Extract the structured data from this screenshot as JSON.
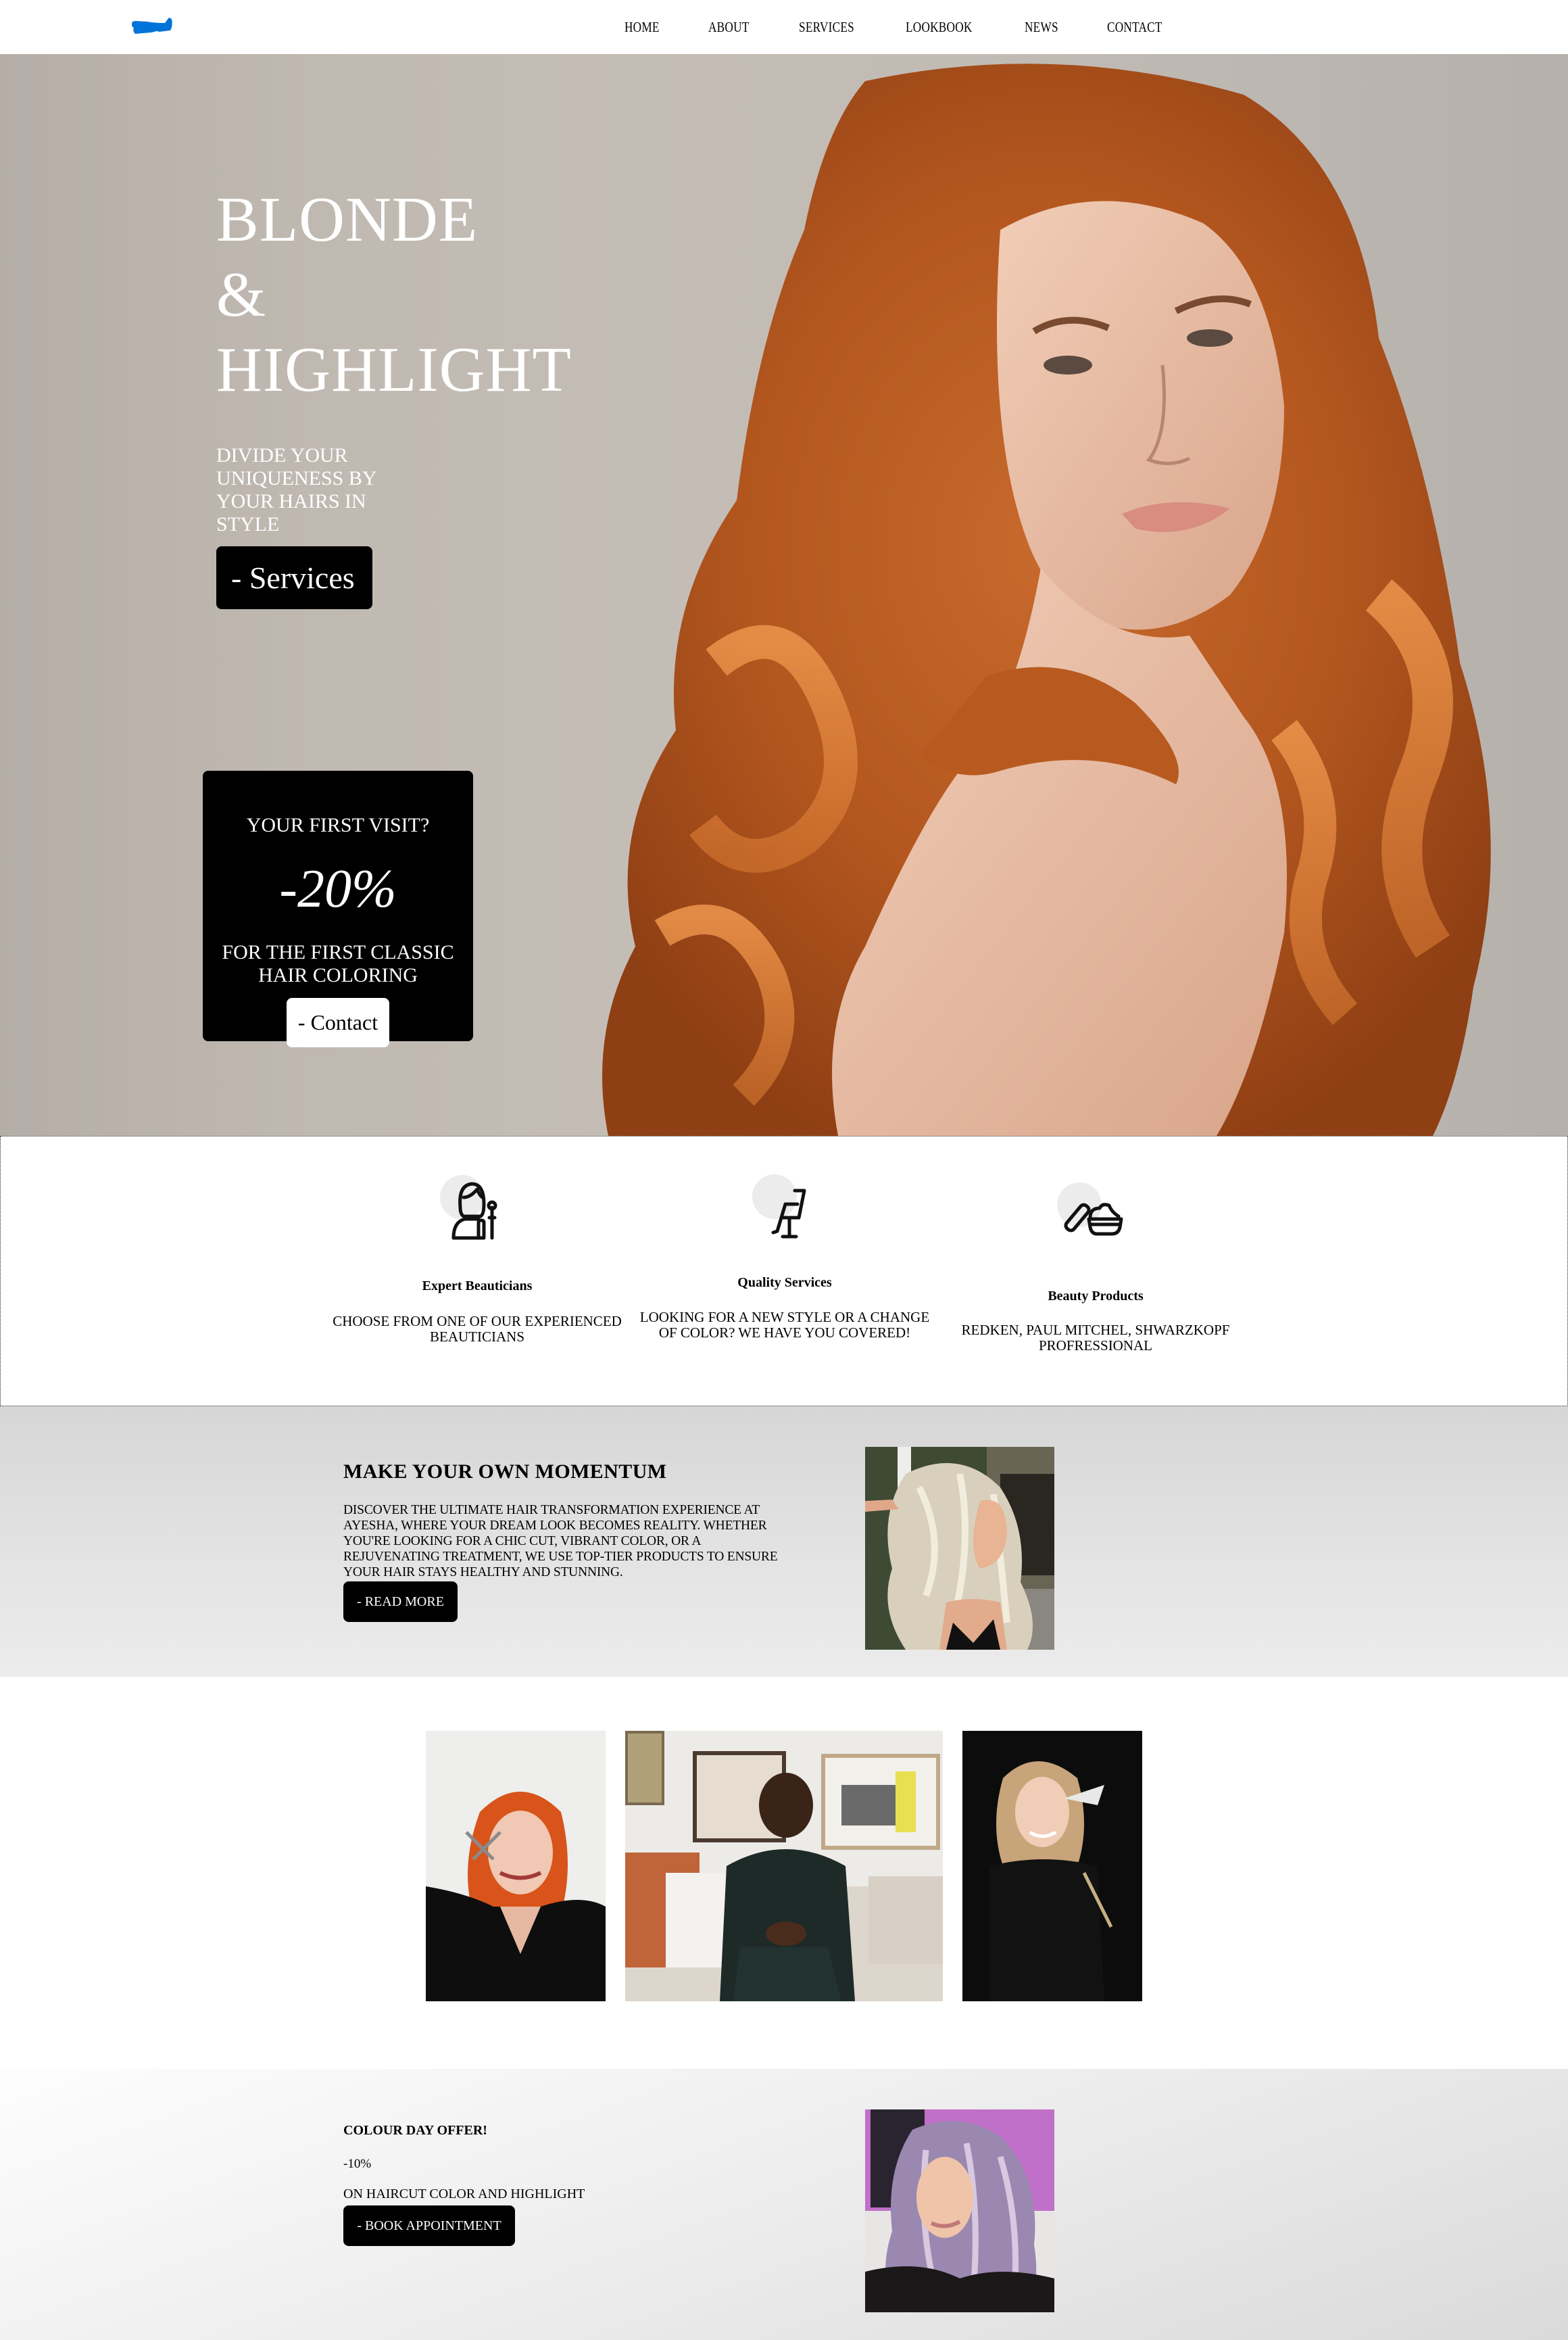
{
  "header": {
    "logo_alt": "Salon logo (blue brush stroke)",
    "logo_color": "#0074d9",
    "nav": [
      {
        "label": "HOME"
      },
      {
        "label": "ABOUT"
      },
      {
        "label": "SERVICES"
      },
      {
        "label": "LOOKBOOK"
      },
      {
        "label": "NEWS"
      },
      {
        "label": "CONTACT"
      }
    ]
  },
  "hero": {
    "title_lines": [
      "BLONDE",
      "&",
      "HIGHLIGHT"
    ],
    "subtitle": "DIVIDE YOUR UNIQUENESS BY YOUR HAIRS IN STYLE",
    "services_button": "- Services",
    "image_alt": "Woman with long wavy copper-red hair",
    "promo": {
      "question": "YOUR FIRST VISIT?",
      "discount": "-20%",
      "description": "FOR THE FIRST CLASSIC HAIR COLORING",
      "contact_button": "- Contact"
    }
  },
  "features": [
    {
      "icon": "beautician-icon",
      "title": "Expert Beauticians",
      "description": "CHOOSE FROM ONE OF OUR EXPERIENCED BEAUTICIANS"
    },
    {
      "icon": "salon-chair-icon",
      "title": "Quality Services",
      "description": "LOOKING FOR A NEW STYLE OR A CHANGE OF COLOR? WE HAVE YOU COVERED!"
    },
    {
      "icon": "cream-jar-icon",
      "title": "Beauty Products",
      "description": "REDKEN, PAUL MITCHEL, SHWARZKOPF PROFRESSIONAL"
    }
  ],
  "momentum": {
    "title": "MAKE YOUR OWN MOMENTUM",
    "body": "DISCOVER THE ULTIMATE HAIR TRANSFORMATION EXPERIENCE AT AYESHA, WHERE YOUR DREAM LOOK BECOMES REALITY. WHETHER YOU'RE LOOKING FOR A CHIC CUT, VIBRANT COLOR, OR A REJUVENATING TREATMENT, WE USE TOP-TIER PRODUCTS TO ENSURE YOUR HAIR STAYS HEALTHY AND STUNNING.",
    "button": "- READ MORE",
    "image_alt": "Woman with long wavy platinum blonde hair"
  },
  "team": [
    {
      "image_alt": "Stylist with red hair holding scissors"
    },
    {
      "image_alt": "Stylist seated on a sofa"
    },
    {
      "image_alt": "Makeup artist holding brushes"
    }
  ],
  "offer": {
    "title": "COLOUR DAY OFFER!",
    "discount": "-10%",
    "description": "ON HAIRCUT COLOR AND HIGHLIGHT",
    "button": "- BOOK APPOINTMENT",
    "image_alt": "Woman with lavender pastel wavy hair"
  }
}
